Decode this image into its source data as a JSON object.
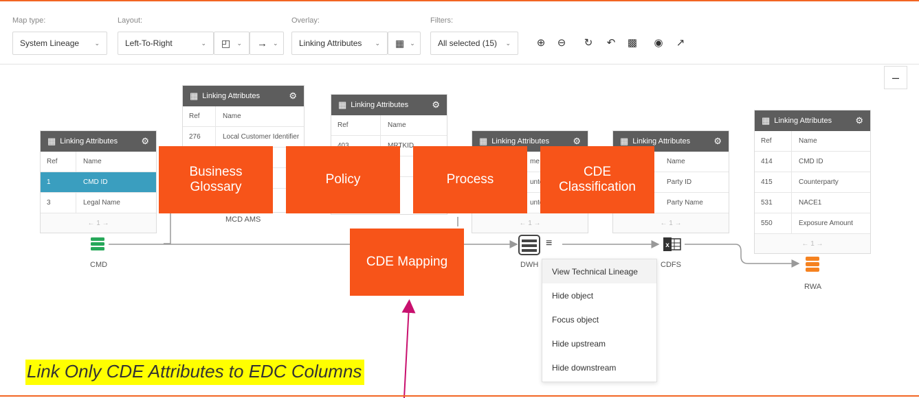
{
  "toolbar": {
    "map_type_label": "Map type:",
    "map_type_value": "System Lineage",
    "layout_label": "Layout:",
    "layout_value": "Left-To-Right",
    "overlay_label": "Overlay:",
    "overlay_value": "Linking Attributes",
    "filters_label": "Filters:",
    "filters_value": "All selected (15)"
  },
  "collapse_glyph": "–",
  "tables": {
    "cmd": {
      "title": "Linking Attributes",
      "col_ref": "Ref",
      "col_name": "Name",
      "rows": [
        {
          "ref": "1",
          "name": "CMD ID"
        },
        {
          "ref": "3",
          "name": "Legal Name"
        }
      ],
      "pager": "← 1 →"
    },
    "mcd": {
      "title": "Linking Attributes",
      "col_ref": "Ref",
      "col_name": "Name",
      "rows": [
        {
          "ref": "276",
          "name": "Local Customer Identifier"
        }
      ]
    },
    "t3": {
      "title": "Linking Attributes",
      "col_ref": "Ref",
      "col_name": "Name",
      "rows": [
        {
          "ref": "403",
          "name": "MRTKID"
        }
      ]
    },
    "dwh": {
      "title": "Linking Attributes",
      "partial": [
        "me",
        "unte",
        "unte"
      ],
      "pager": "← 1 →"
    },
    "cdfs": {
      "title": "Linking Attributes",
      "col_name": "Name",
      "rows": [
        {
          "name": "Party ID"
        },
        {
          "name": "Party Name"
        }
      ],
      "pager": "← 1 →"
    },
    "rwa": {
      "title": "Linking Attributes",
      "col_ref": "Ref",
      "col_name": "Name",
      "rows": [
        {
          "ref": "414",
          "name": "CMD ID"
        },
        {
          "ref": "415",
          "name": "Counterparty"
        },
        {
          "ref": "531",
          "name": "NACE1"
        },
        {
          "ref": "550",
          "name": "Exposure Amount"
        }
      ],
      "pager": "← 1 →"
    }
  },
  "nodes": {
    "cmd": "CMD",
    "mcd": "MCD AMS",
    "dwh": "DWH",
    "cdfs": "CDFS",
    "rwa": "RWA"
  },
  "overlays": {
    "business_glossary_line1": "Business",
    "business_glossary_line2": "Glossary",
    "policy": "Policy",
    "process": "Process",
    "cde_class_line1": "CDE",
    "cde_class_line2": "Classification",
    "cde_mapping": "CDE Mapping"
  },
  "context_menu": [
    "View Technical Lineage",
    "Hide object",
    "Focus object",
    "Hide upstream",
    "Hide downstream"
  ],
  "note": "Link Only CDE Attributes to EDC Columns",
  "colors": {
    "accent": "#f26522",
    "overlay_box": "#f75419",
    "selected_row": "#3a9ebf",
    "table_header": "#5d5d5d",
    "db_green": "#27a85a",
    "db_orange": "#f58220",
    "arrow_magenta": "#c8106e",
    "note_highlight": "#ffff00"
  }
}
